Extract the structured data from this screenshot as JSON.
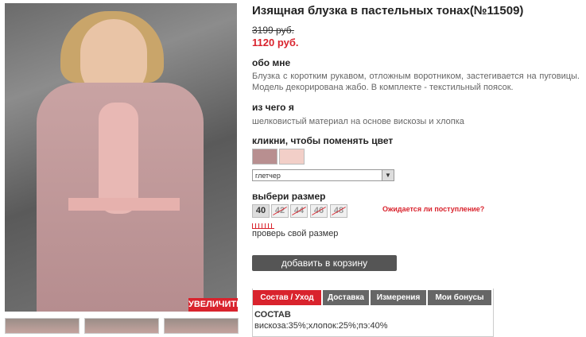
{
  "product": {
    "title": "Изящная блузка в пастельных тонах(№11509)",
    "old_price": "3199 руб.",
    "price": "1120 руб.",
    "zoom_label": "УВЕЛИЧИТЬ"
  },
  "about": {
    "heading": "обо мне",
    "text": "Блузка с коротким рукавом, отложным воротником, застегивается на пуговицы. Модель декорирована жабо. В комплекте - текстильный поясок."
  },
  "material": {
    "heading": "из чего я",
    "text": "шелковистый материал на основе вискозы и хлопка"
  },
  "color": {
    "heading": "кликни, чтобы поменять цвет",
    "selected": "глетчер",
    "swatches": [
      "#b88f90",
      "#f2cfc8"
    ]
  },
  "size": {
    "heading": "выбери размер",
    "options": [
      {
        "label": "40",
        "available": true
      },
      {
        "label": "42",
        "available": false
      },
      {
        "label": "44",
        "available": false
      },
      {
        "label": "46",
        "available": false
      },
      {
        "label": "48",
        "available": false
      }
    ],
    "expect_link": "Ожидается ли поступление?",
    "check_link": "проверь свой размер"
  },
  "cart": {
    "button": "добавить в корзину"
  },
  "tabs": [
    "Состав / Уход",
    "Доставка",
    "Измерения",
    "Мои бонусы"
  ],
  "composition": {
    "heading": "СОСТАВ",
    "value": "вискоза:35%;хлопок:25%;пэ:40%"
  },
  "colors": {
    "accent": "#d9232d",
    "tab_inactive": "#666666",
    "button": "#555555"
  }
}
